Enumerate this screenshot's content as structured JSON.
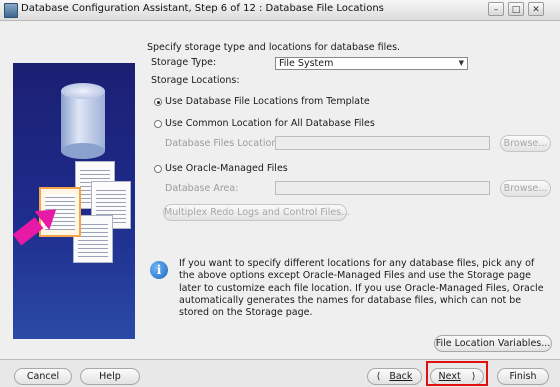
{
  "window": {
    "title": "Database Configuration Assistant, Step 6 of 12 : Database File Locations",
    "min_glyph": "–",
    "max_glyph": "□",
    "close_glyph": "✕"
  },
  "intro": "Specify storage type and locations for database files.",
  "storage_type": {
    "label": "Storage Type:",
    "value": "File System"
  },
  "storage_locations_label": "Storage Locations:",
  "options": {
    "template": "Use Database File Locations from Template",
    "common": "Use Common Location for All Database Files",
    "common_field_label": "Database Files Location:",
    "common_field_value": "",
    "oracle_managed": "Use Oracle-Managed Files",
    "area_field_label": "Database Area:",
    "area_field_value": "",
    "browse": "Browse...",
    "multiplex": "Multiplex Redo Logs and Control Files..."
  },
  "info": {
    "icon": "i",
    "text": "If you want to specify different locations for any database files, pick any of the above options except Oracle-Managed Files and use the Storage page later to customize each file location. If you use Oracle-Managed Files, Oracle automatically generates the names for database files, which can not be stored on the Storage page."
  },
  "file_location_variables": "File Location Variables...",
  "footer": {
    "cancel": "Cancel",
    "help": "Help",
    "back_arrow": "⟨",
    "back": "Back",
    "next": "Next",
    "next_arrow": "⟩",
    "finish": "Finish"
  },
  "colors": {
    "banner": "#1e2c8c",
    "highlight": "#e01010",
    "arrow": "#e61aa5",
    "info_icon": "#1a67c4"
  },
  "selected_option": "template"
}
